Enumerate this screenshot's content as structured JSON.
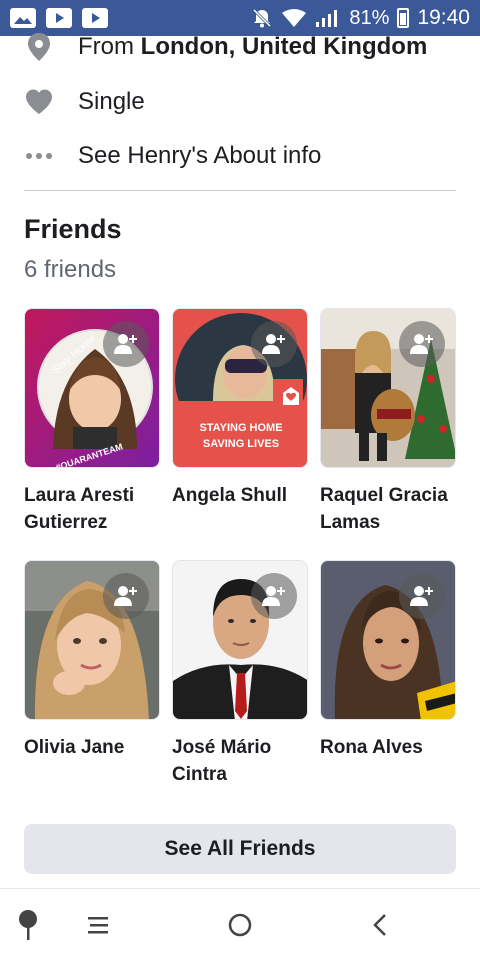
{
  "status_bar": {
    "battery_percent": "81%",
    "time": "19:40",
    "icons": [
      "gallery-icon",
      "youtube-icon",
      "youtube-icon",
      "mute-icon",
      "wifi-icon",
      "signal-icon",
      "battery-icon"
    ]
  },
  "about": {
    "from_prefix": "From ",
    "from_location": "London, United Kingdom",
    "relationship": "Single",
    "see_about": "See Henry's About info"
  },
  "friends": {
    "title": "Friends",
    "count": "6 friends",
    "list": [
      {
        "name": "Laura Aresti Gutierrez",
        "frame_text_top": "Stay Home",
        "frame_text_bottom": "#QUARANTEAM"
      },
      {
        "name": "Angela Shull",
        "frame_text_line1": "STAYING HOME",
        "frame_text_line2": "SAVING LIVES"
      },
      {
        "name": "Raquel Gracia Lamas"
      },
      {
        "name": "Olivia Jane"
      },
      {
        "name": "José Mário Cintra"
      },
      {
        "name": "Rona Alves"
      }
    ],
    "see_all_label": "See All Friends"
  },
  "colors": {
    "status_bar": "#3b5998",
    "text_primary": "#1c1e21",
    "text_secondary": "#606770",
    "button_bg": "#e4e6eb"
  }
}
